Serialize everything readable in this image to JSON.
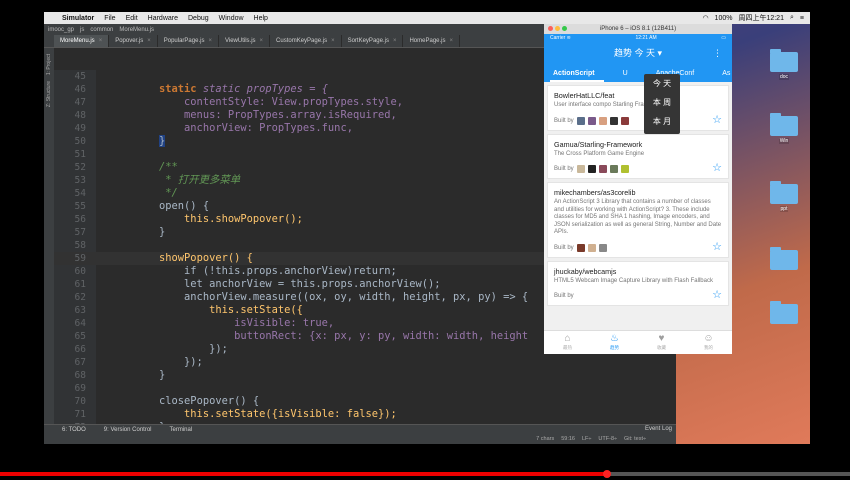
{
  "menubar": {
    "apple": "",
    "app": "Simulator",
    "items": [
      "File",
      "Edit",
      "Hardware",
      "Debug",
      "Window",
      "Help"
    ],
    "battery": "100%",
    "clock": "周四上午12:21"
  },
  "ide": {
    "breadcrumbs": [
      "imooc_gp",
      "js",
      "common",
      "MoreMenu.js"
    ],
    "tabs": [
      "MoreMenu.js",
      "Popover.js",
      "PopularPage.js",
      "ViewUtils.js",
      "CustomKeyPage.js",
      "SortKeyPage.js",
      "HomePage.js"
    ],
    "active_tab": "MoreMenu.js",
    "left_strip": [
      "1: Project",
      "Z: Structure"
    ],
    "bottom_tools": [
      "6: TODO",
      "9: Version Control",
      "Terminal"
    ],
    "event_log": "Event Log",
    "status": [
      "7 chars",
      "59:16",
      "LF÷",
      "UTF-8÷",
      "Git: test÷"
    ]
  },
  "code": [
    {
      "n": "45",
      "t": ""
    },
    {
      "n": "46",
      "t": "static propTypes = {"
    },
    {
      "n": "47",
      "t": "contentStyle: View.propTypes.style,"
    },
    {
      "n": "48",
      "t": "menus: PropTypes.array.isRequired,"
    },
    {
      "n": "49",
      "t": "anchorView: PropTypes.func,"
    },
    {
      "n": "50",
      "t": "}"
    },
    {
      "n": "51",
      "t": ""
    },
    {
      "n": "52",
      "t": "/**"
    },
    {
      "n": "53",
      "t": " * 打开更多菜单"
    },
    {
      "n": "54",
      "t": " */"
    },
    {
      "n": "55",
      "t": "open() {"
    },
    {
      "n": "56",
      "t": "this.showPopover();"
    },
    {
      "n": "57",
      "t": "}"
    },
    {
      "n": "58",
      "t": ""
    },
    {
      "n": "59",
      "t": "showPopover() {"
    },
    {
      "n": "60",
      "t": "if (!this.props.anchorView)return;"
    },
    {
      "n": "61",
      "t": "let anchorView = this.props.anchorView();"
    },
    {
      "n": "62",
      "t": "anchorView.measure((ox, oy, width, height, px, py) => {"
    },
    {
      "n": "63",
      "t": "this.setState({"
    },
    {
      "n": "64",
      "t": "isVisible: true,"
    },
    {
      "n": "65",
      "t": "buttonRect: {x: px, y: py, width: width, height"
    },
    {
      "n": "66",
      "t": "});"
    },
    {
      "n": "67",
      "t": "});"
    },
    {
      "n": "68",
      "t": "}"
    },
    {
      "n": "69",
      "t": ""
    },
    {
      "n": "70",
      "t": "closePopover() {"
    },
    {
      "n": "71",
      "t": "this.setState({isVisible: false});"
    },
    {
      "n": "72",
      "t": "}"
    }
  ],
  "simulator": {
    "window_title": "iPhone 6 – iOS 8.1 (12B411)",
    "status_left": "Carrier ≋",
    "status_time": "12:21 AM",
    "nav_title": "趋势 今 天 ▾",
    "menu_dots": "⋮",
    "tabs": [
      "ActionScript",
      "U",
      "ApacheConf",
      "As"
    ],
    "popover": [
      "今 天",
      "本 周",
      "本 月"
    ],
    "repos": [
      {
        "name": "BowlerHatLLC/feat",
        "desc": "User interface compo                Starling Framework",
        "built": "Built by"
      },
      {
        "name": "Gamua/Starling-Framework",
        "desc": "The Cross Platform Game Engine",
        "built": "Built by"
      },
      {
        "name": "mikechambers/as3corelib",
        "desc": "An ActionScript 3 Library that contains a number of classes and utilities for working with ActionScript? 3. These include classes for MD5 and SHA 1 hashing, Image encoders, and JSON serialization as well as general String, Number and Date APIs.",
        "built": "Built by"
      },
      {
        "name": "jhuckaby/webcamjs",
        "desc": "HTML5 Webcam Image Capture Library with Flash Fallback",
        "built": "Built by"
      }
    ],
    "bottom_tabs": [
      "最热",
      "趋势",
      "收藏",
      "我的"
    ]
  },
  "folders": [
    "doc",
    "Win",
    "ppt",
    "",
    ""
  ],
  "colors": {
    "accent": "#2196f3",
    "ide_bg": "#2b2b2b"
  }
}
